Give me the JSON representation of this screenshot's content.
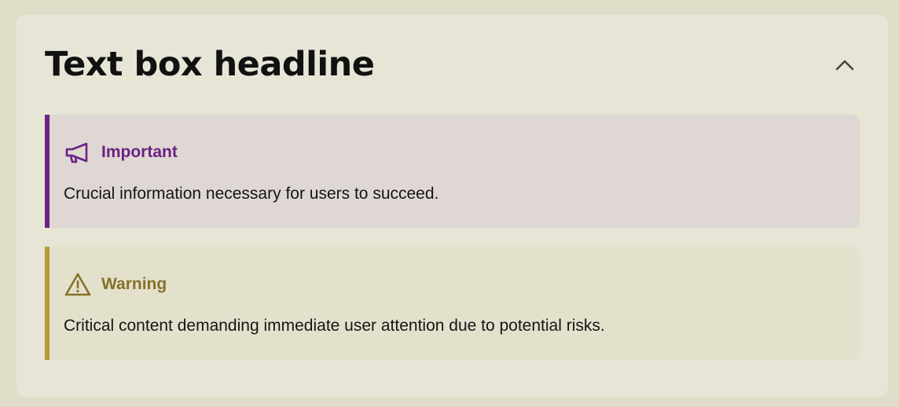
{
  "textbox": {
    "headline": "Text box headline",
    "collapse_icon": "chevron-up-icon"
  },
  "callouts": [
    {
      "kind": "important",
      "icon": "megaphone-icon",
      "title": "Important",
      "body": "Crucial information necessary for users to succeed.",
      "accent_color": "#6a2283",
      "background_color": "#dfd7d3"
    },
    {
      "kind": "warning",
      "icon": "warning-triangle-icon",
      "title": "Warning",
      "body": "Critical content demanding immediate user attention due to potential risks.",
      "accent_color": "#b79b33",
      "title_color": "#87702a",
      "background_color": "#e3e1cc"
    }
  ],
  "colors": {
    "page_background": "#dfddc8",
    "panel_background": "#e7e5d6",
    "text": "#111111"
  }
}
